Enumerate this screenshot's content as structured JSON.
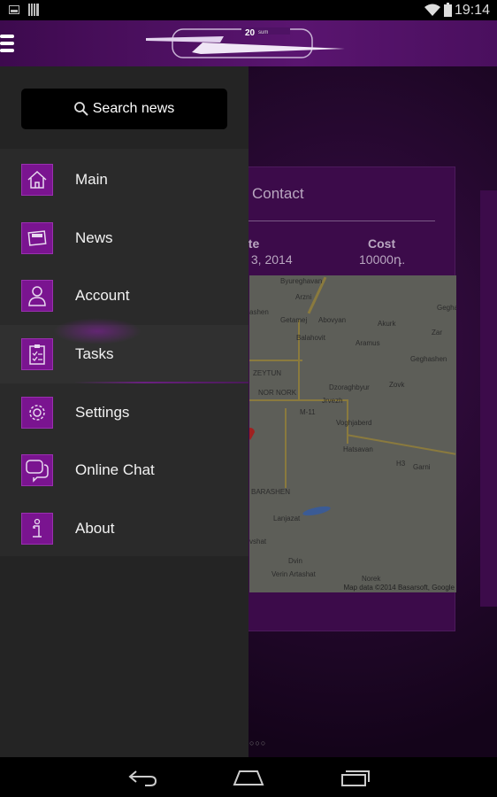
{
  "status_bar": {
    "time": "19:14",
    "icons": [
      "image-icon",
      "barcode-icon",
      "wifi-icon",
      "battery-icon"
    ]
  },
  "header": {
    "logo_text": "20 sum",
    "menu_icon": "hamburger-icon"
  },
  "drawer": {
    "search_label": "Search news",
    "items": [
      {
        "label": "Main",
        "icon": "home-icon"
      },
      {
        "label": "News",
        "icon": "newspaper-icon"
      },
      {
        "label": "Account",
        "icon": "user-icon"
      },
      {
        "label": "Tasks",
        "icon": "clipboard-icon",
        "active": true
      },
      {
        "label": "Settings",
        "icon": "gear-icon"
      },
      {
        "label": "Online Chat",
        "icon": "chat-icon"
      },
      {
        "label": "About",
        "icon": "info-icon"
      }
    ]
  },
  "card": {
    "title": "Contact",
    "date_header": "ate",
    "date_value": "v 3, 2014",
    "cost_header": "Cost",
    "cost_value": "10000դ.",
    "map": {
      "places": [
        "Byureghavan",
        "Arzni",
        "ashen",
        "Getamej",
        "Abovyan",
        "Akurk",
        "Zar",
        "Balahovit",
        "Aramus",
        "Geghashen",
        "ZEYTUN",
        "NOR NORK",
        "Dzoraghbyur",
        "Zovk",
        "Jrvezh",
        "M-11",
        "Voghjaberd",
        "Hatsavan",
        "H3",
        "Garni",
        "BARASHEN",
        "Lanjazat",
        "vshat",
        "Dvin",
        "Verin Artashat",
        "Norek",
        "Geghad"
      ],
      "attribution": "Map data ©2014 Basarsoft, Google"
    }
  },
  "accent_color": "#7a1490"
}
